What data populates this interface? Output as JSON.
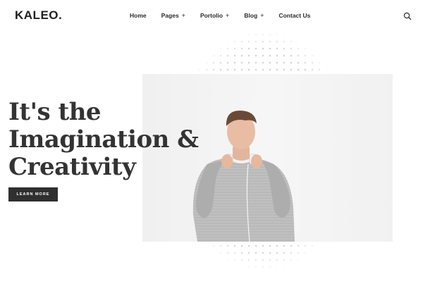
{
  "header": {
    "logo": "KALEO.",
    "nav": [
      {
        "label": "Home",
        "expandable": false
      },
      {
        "label": "Pages",
        "expandable": true
      },
      {
        "label": "Portolio",
        "expandable": true
      },
      {
        "label": "Blog",
        "expandable": true
      },
      {
        "label": "Contact Us",
        "expandable": false
      }
    ],
    "plus_glyph": "+",
    "search_icon": "search-icon"
  },
  "hero": {
    "headline_lines": [
      "It's the",
      "Imagination &",
      "Creativity"
    ],
    "cta_label": "LEARN MORE",
    "image_icon": "person-with-headphones-photo",
    "dot_color": "#d3d3d3",
    "cta_color": "#2f2f2f",
    "text_color": "#333333"
  }
}
